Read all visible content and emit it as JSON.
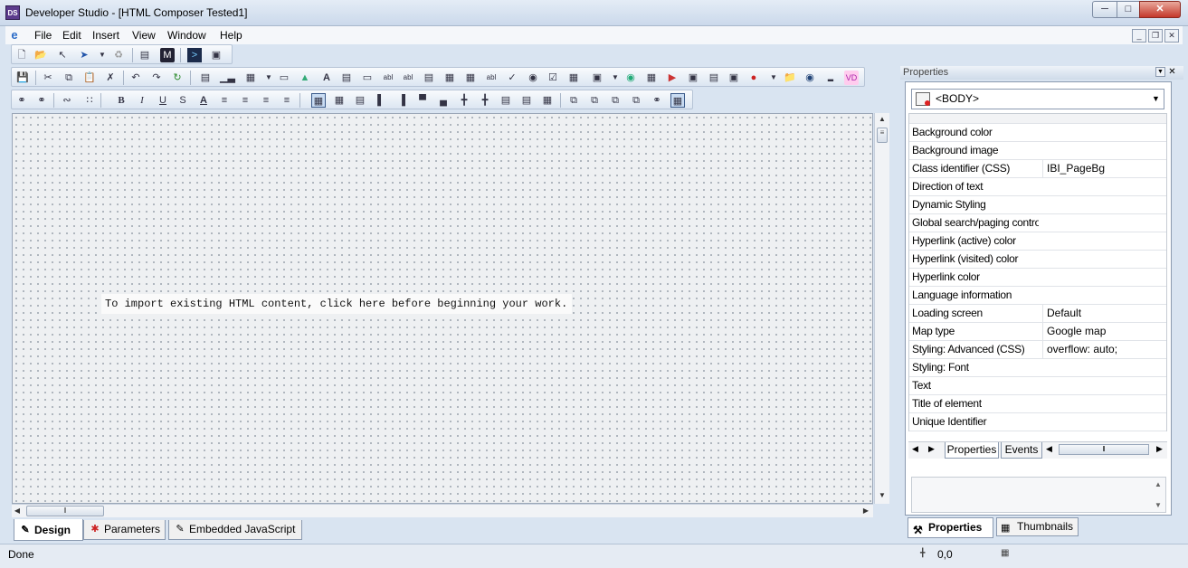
{
  "window": {
    "title": "Developer Studio - [HTML Composer Tested1]",
    "app_icon": "DS"
  },
  "menu": [
    "File",
    "Edit",
    "Insert",
    "View",
    "Window",
    "Help"
  ],
  "canvas": {
    "import_hint": "To import existing HTML content, click here before beginning your work."
  },
  "doc_tabs": [
    "Design",
    "Parameters",
    "Embedded JavaScript"
  ],
  "status": {
    "text": "Done",
    "coords": "0,0"
  },
  "properties": {
    "panel_title": "Properties",
    "selected_element": "<BODY>",
    "rows": [
      {
        "name": "Background color",
        "value": ""
      },
      {
        "name": "Background image",
        "value": ""
      },
      {
        "name": "Class identifier (CSS)",
        "value": "IBI_PageBg"
      },
      {
        "name": "Direction of text",
        "value": ""
      },
      {
        "name": "Dynamic Styling",
        "value": ""
      },
      {
        "name": "Global search/paging control",
        "value": ""
      },
      {
        "name": "Hyperlink (active) color",
        "value": ""
      },
      {
        "name": "Hyperlink (visited) color",
        "value": ""
      },
      {
        "name": "Hyperlink color",
        "value": ""
      },
      {
        "name": "Language information",
        "value": ""
      },
      {
        "name": "Loading screen",
        "value": "Default"
      },
      {
        "name": "Map type",
        "value": "Google map"
      },
      {
        "name": "Styling: Advanced (CSS)",
        "value": "overflow: auto;"
      },
      {
        "name": "Styling: Font",
        "value": ""
      },
      {
        "name": "Text",
        "value": ""
      },
      {
        "name": "Title of element",
        "value": ""
      },
      {
        "name": "Unique Identifier",
        "value": ""
      }
    ],
    "inner_tabs": [
      "Properties",
      "Events"
    ],
    "bottom_tabs": [
      "Properties",
      "Thumbnails"
    ]
  },
  "format_glyphs": {
    "bold": "B",
    "italic": "I",
    "underline": "U",
    "strike": "S",
    "color": "A"
  }
}
